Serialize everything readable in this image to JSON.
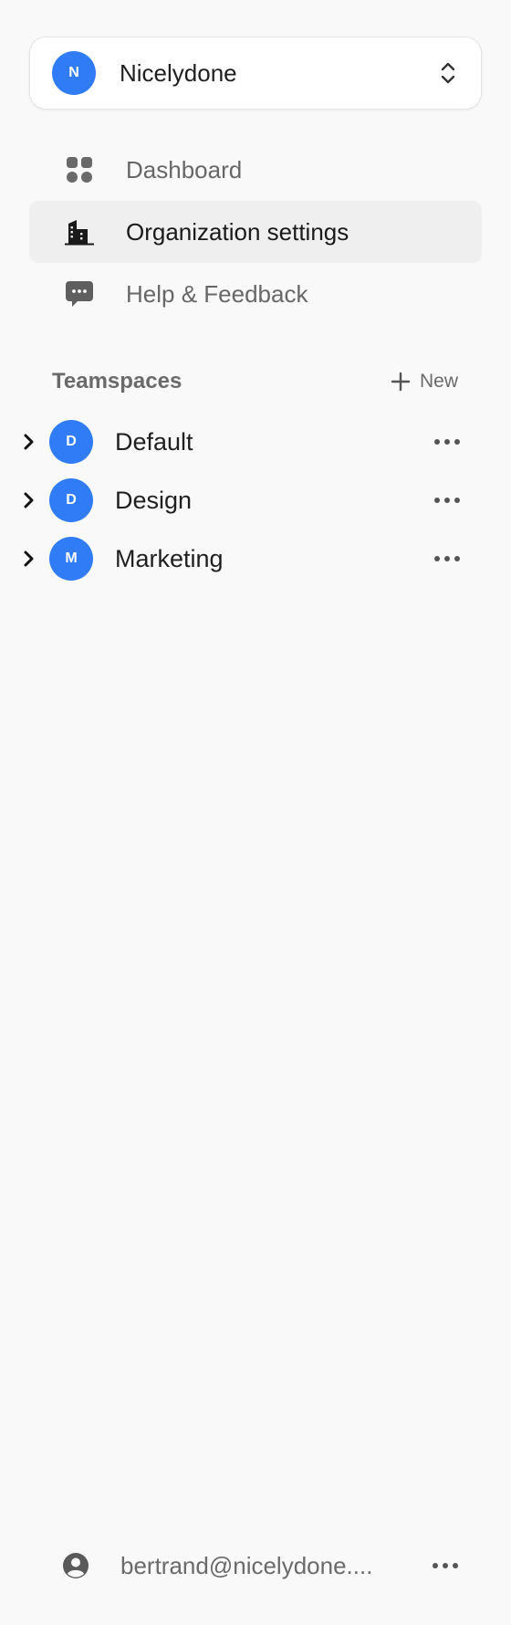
{
  "organization": {
    "avatar_letter": "N",
    "name": "Nicelydone",
    "switcher_icon": "chevron-up-down-icon"
  },
  "nav": [
    {
      "label": "Dashboard",
      "icon": "dashboard-grid-icon",
      "active": false
    },
    {
      "label": "Organization settings",
      "icon": "building-icon",
      "active": true
    },
    {
      "label": "Help & Feedback",
      "icon": "chat-bubble-icon",
      "active": false
    }
  ],
  "teamspaces": {
    "title": "Teamspaces",
    "new_label": "New",
    "items": [
      {
        "letter": "D",
        "name": "Default"
      },
      {
        "letter": "D",
        "name": "Design"
      },
      {
        "letter": "M",
        "name": "Marketing"
      }
    ]
  },
  "user": {
    "email": "bertrand@nicelydone....",
    "icon": "user-circle-icon"
  },
  "colors": {
    "accent": "#2f7cf6",
    "background": "#f9f9f9",
    "active_item": "#efefef",
    "muted_text": "#676767"
  }
}
